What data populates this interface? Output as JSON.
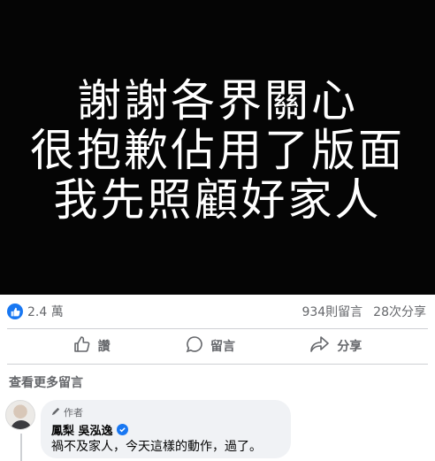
{
  "post": {
    "image_lines": [
      "謝謝各界關心",
      "很抱歉佔用了版面",
      "我先照顧好家人"
    ]
  },
  "stats": {
    "reaction_count": "2.4 萬",
    "comments": "934則留言",
    "shares": "28次分享"
  },
  "actions": {
    "like": "讚",
    "comment": "留言",
    "share": "分享"
  },
  "comments_section": {
    "view_more": "查看更多留言",
    "items": [
      {
        "badge": "作者",
        "name": "鳳梨 吳泓逸",
        "text": "禍不及家人，今天這樣的動作，過了。"
      }
    ]
  },
  "colors": {
    "brand_blue": "#1877f2",
    "secondary_text": "#65676b",
    "bubble_bg": "#f0f2f5"
  }
}
